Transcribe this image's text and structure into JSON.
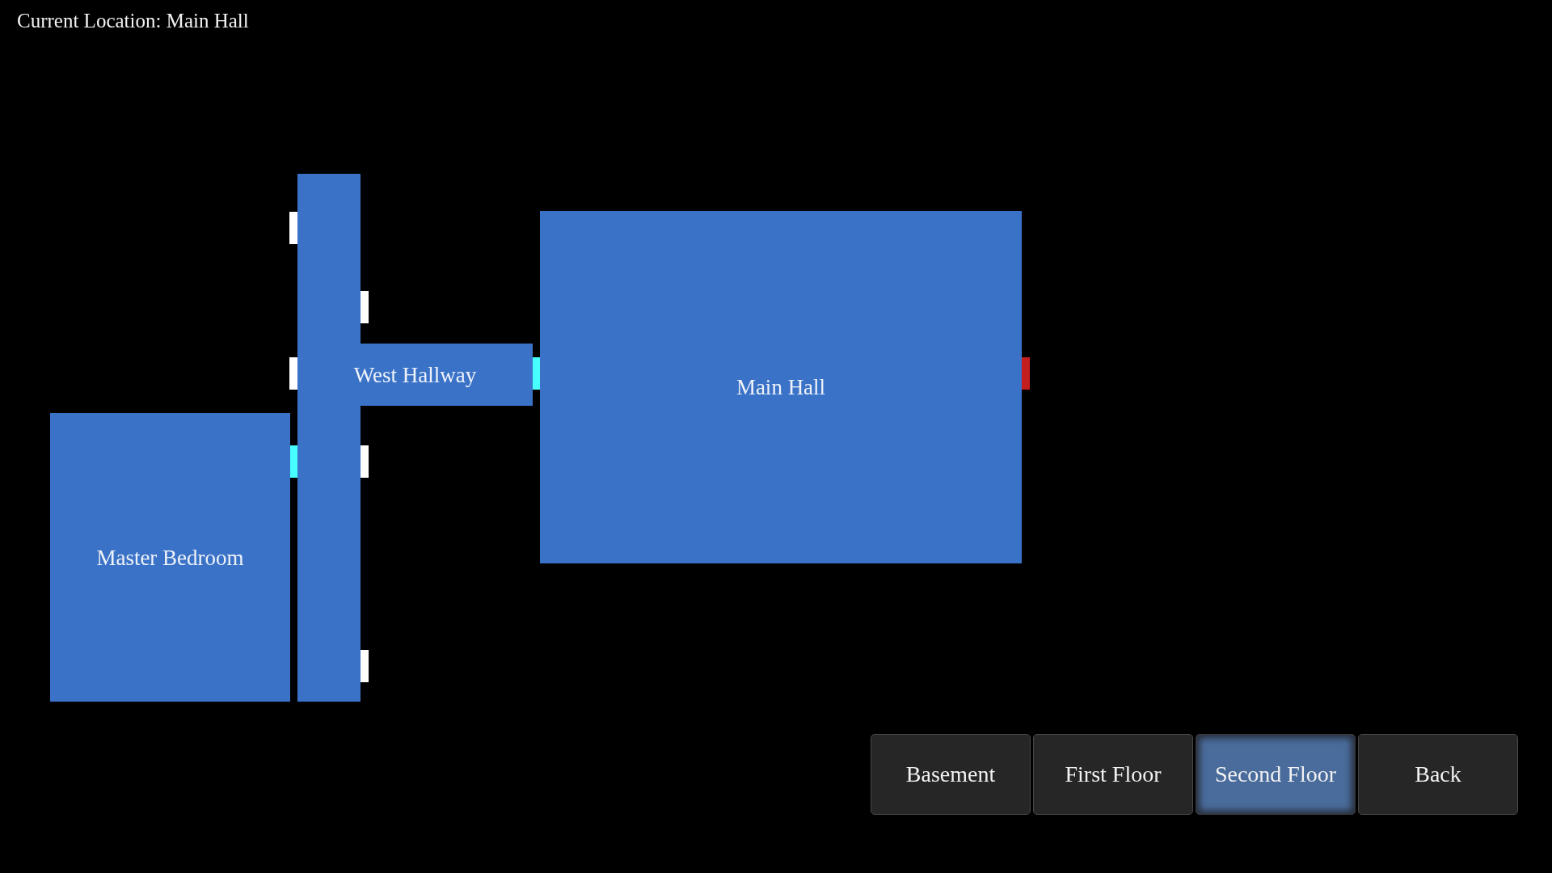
{
  "header": {
    "location": "Current Location: Main Hall"
  },
  "map": {
    "rooms": [
      {
        "name": "West Hallway",
        "kind": "hallway"
      },
      {
        "name": "Main Hall",
        "kind": "room"
      },
      {
        "name": "Master Bedroom",
        "kind": "room"
      }
    ],
    "doors": [
      {
        "color": "#ffffff"
      },
      {
        "color": "#ffffff"
      },
      {
        "color": "#ffffff"
      },
      {
        "color": "#47ffff"
      },
      {
        "color": "#c41e1e"
      },
      {
        "color": "#47ffff"
      },
      {
        "color": "#ffffff"
      },
      {
        "color": "#ffffff"
      }
    ]
  },
  "floor_tabs": [
    {
      "label": "Basement",
      "selected": false
    },
    {
      "label": "First Floor",
      "selected": false
    },
    {
      "label": "Second Floor",
      "selected": true
    }
  ],
  "back_button": {
    "label": "Back"
  }
}
